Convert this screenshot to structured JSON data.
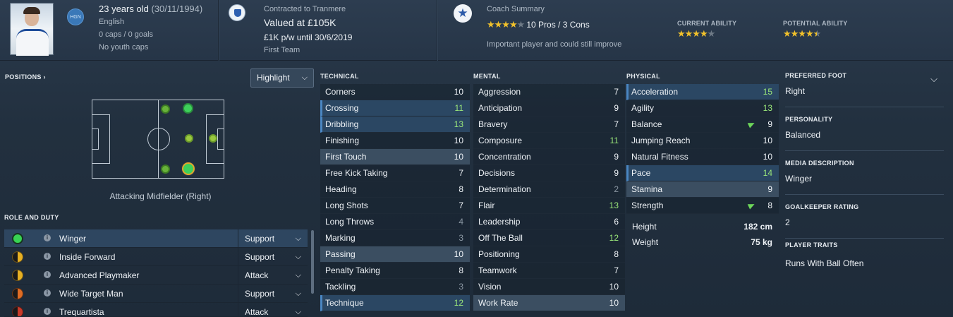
{
  "header": {
    "age": "23 years old",
    "dob": "(30/11/1994)",
    "nationality": "English",
    "nation_badge": "HGN",
    "caps": "0 caps / 0 goals",
    "youth_caps": "No youth caps",
    "contract": "Contracted to Tranmere",
    "value": "Valued at £105K",
    "wage": "£1K p/w until 30/6/2019",
    "squad_status": "First Team",
    "coach_summary_label": "Coach Summary",
    "pros_cons": "10 Pros / 3 Cons",
    "coach_stars": 4,
    "coach_note": "Important player and could still improve",
    "current_ability_label": "CURRENT ABILITY",
    "current_ability_stars": 4,
    "potential_ability_label": "POTENTIAL ABILITY",
    "potential_ability_stars": 4.5
  },
  "positions": {
    "title": "POSITIONS",
    "dropdown": "Highlight",
    "selected_label": "Attacking Midfielder (Right)"
  },
  "roles": {
    "title": "ROLE AND DUTY",
    "items": [
      {
        "name": "Winger",
        "duty": "Support",
        "rating": "green"
      },
      {
        "name": "Inside Forward",
        "duty": "Support",
        "rating": "yellow"
      },
      {
        "name": "Advanced Playmaker",
        "duty": "Attack",
        "rating": "yellow"
      },
      {
        "name": "Wide Target Man",
        "duty": "Support",
        "rating": "orange"
      },
      {
        "name": "Trequartista",
        "duty": "Attack",
        "rating": "red"
      }
    ]
  },
  "technical": {
    "title": "TECHNICAL",
    "items": [
      {
        "name": "Corners",
        "value": "10"
      },
      {
        "name": "Crossing",
        "value": "11"
      },
      {
        "name": "Dribbling",
        "value": "13"
      },
      {
        "name": "Finishing",
        "value": "10"
      },
      {
        "name": "First Touch",
        "value": "10"
      },
      {
        "name": "Free Kick Taking",
        "value": "7"
      },
      {
        "name": "Heading",
        "value": "8"
      },
      {
        "name": "Long Shots",
        "value": "7"
      },
      {
        "name": "Long Throws",
        "value": "4"
      },
      {
        "name": "Marking",
        "value": "3"
      },
      {
        "name": "Passing",
        "value": "10"
      },
      {
        "name": "Penalty Taking",
        "value": "8"
      },
      {
        "name": "Tackling",
        "value": "3"
      },
      {
        "name": "Technique",
        "value": "12"
      }
    ]
  },
  "mental": {
    "title": "MENTAL",
    "items": [
      {
        "name": "Aggression",
        "value": "7"
      },
      {
        "name": "Anticipation",
        "value": "9"
      },
      {
        "name": "Bravery",
        "value": "7"
      },
      {
        "name": "Composure",
        "value": "11"
      },
      {
        "name": "Concentration",
        "value": "9"
      },
      {
        "name": "Decisions",
        "value": "9"
      },
      {
        "name": "Determination",
        "value": "2"
      },
      {
        "name": "Flair",
        "value": "13"
      },
      {
        "name": "Leadership",
        "value": "6"
      },
      {
        "name": "Off The Ball",
        "value": "12"
      },
      {
        "name": "Positioning",
        "value": "8"
      },
      {
        "name": "Teamwork",
        "value": "7"
      },
      {
        "name": "Vision",
        "value": "10"
      },
      {
        "name": "Work Rate",
        "value": "10"
      }
    ]
  },
  "physical": {
    "title": "PHYSICAL",
    "items": [
      {
        "name": "Acceleration",
        "value": "15"
      },
      {
        "name": "Agility",
        "value": "13"
      },
      {
        "name": "Balance",
        "value": "9"
      },
      {
        "name": "Jumping Reach",
        "value": "10"
      },
      {
        "name": "Natural Fitness",
        "value": "10"
      },
      {
        "name": "Pace",
        "value": "14"
      },
      {
        "name": "Stamina",
        "value": "9"
      },
      {
        "name": "Strength",
        "value": "8"
      }
    ],
    "height_label": "Height",
    "height": "182 cm",
    "weight_label": "Weight",
    "weight": "75 kg"
  },
  "info": {
    "preferred_foot_label": "PREFERRED FOOT",
    "preferred_foot": "Right",
    "personality_label": "PERSONALITY",
    "personality": "Balanced",
    "media_label": "MEDIA DESCRIPTION",
    "media": "Winger",
    "gk_label": "GOALKEEPER RATING",
    "gk": "2",
    "traits_label": "PLAYER TRAITS",
    "traits": "Runs With Ball Often"
  },
  "colors": {
    "highlight_row": "#2b4763",
    "high_value": "#9be87a",
    "low_value": "#8a96a2",
    "star": "#f1c12b",
    "natural_position": "#3ed05a"
  }
}
